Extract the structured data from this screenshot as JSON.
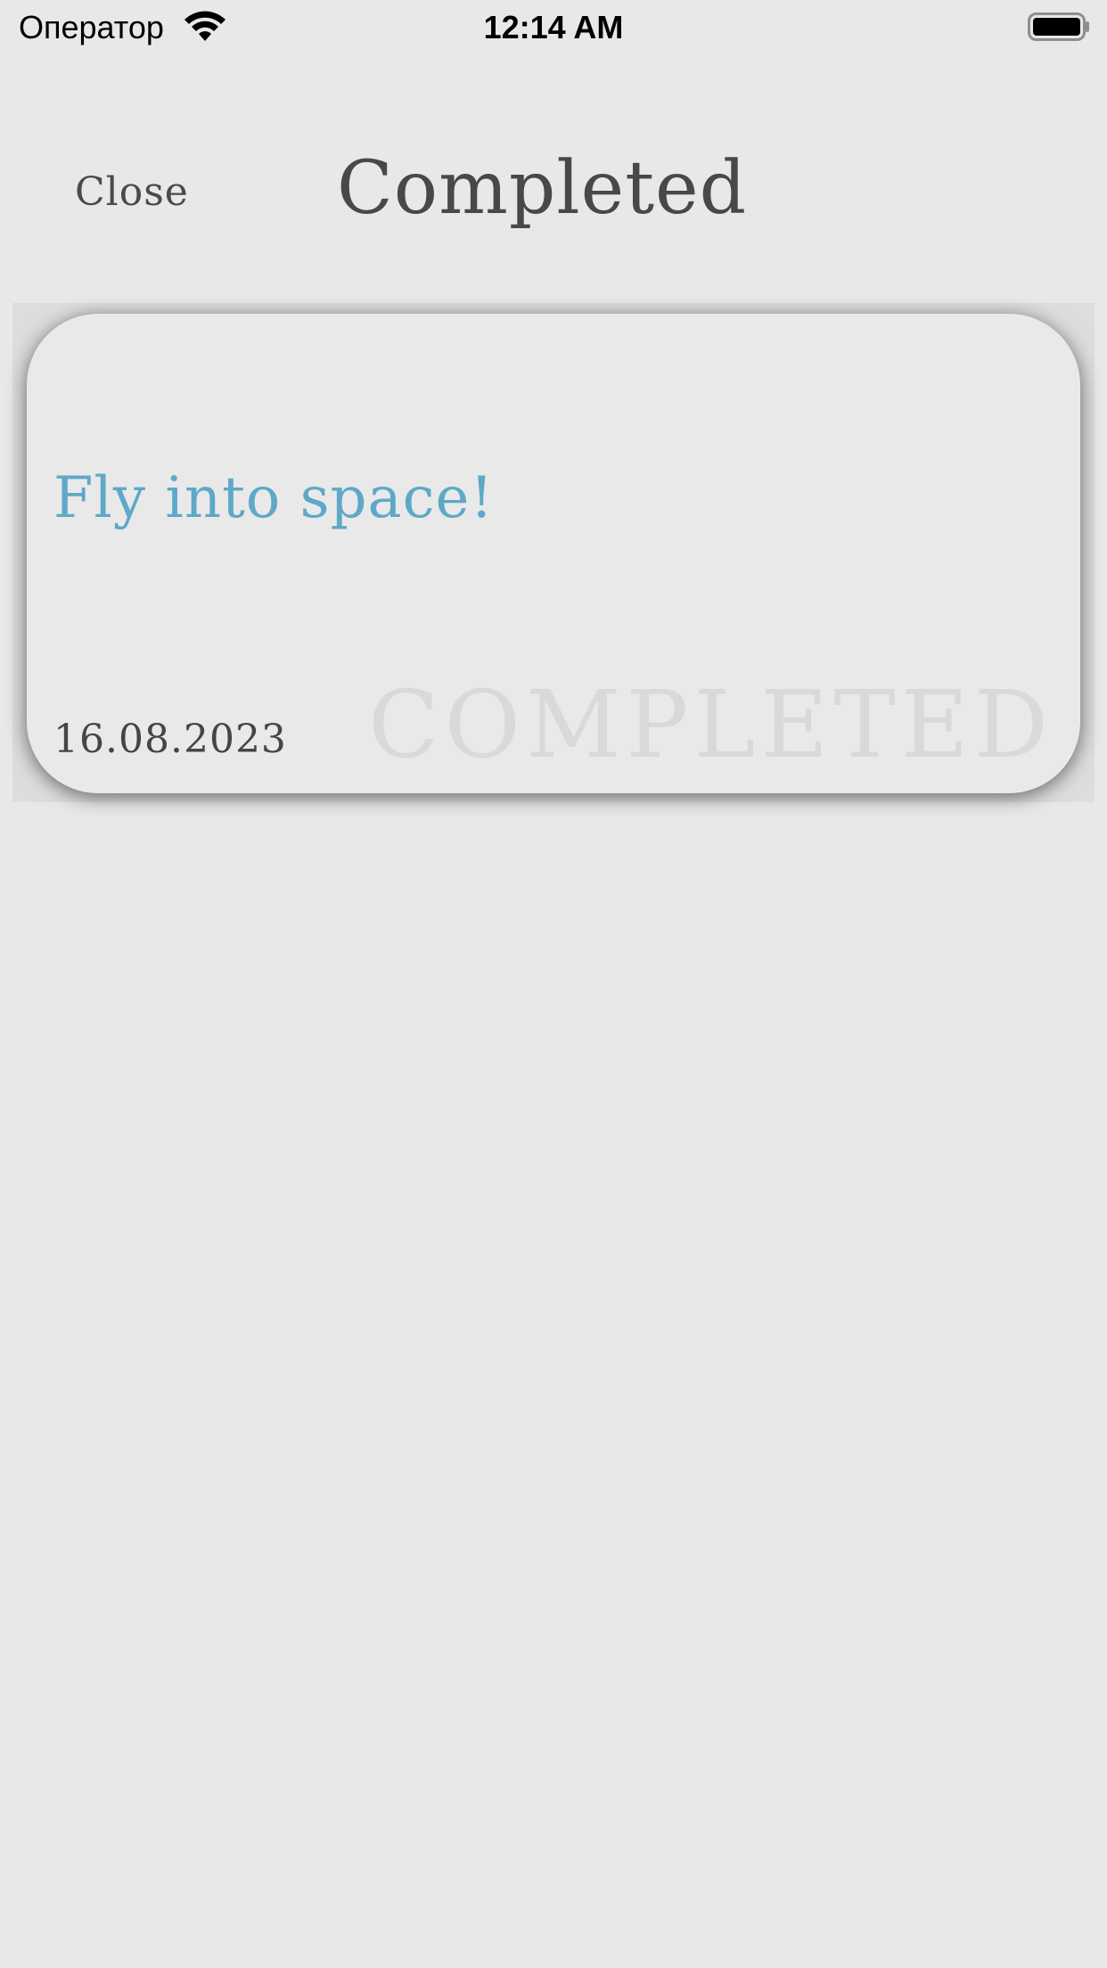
{
  "status_bar": {
    "carrier": "Оператор",
    "time": "12:14 AM",
    "wifi_icon": "wifi-icon",
    "battery_icon": "battery-icon"
  },
  "nav": {
    "close_label": "Close",
    "title": "Completed"
  },
  "task": {
    "title": "Fly into space!",
    "date": "16.08.2023",
    "stamp": "COMPLETED"
  },
  "colors": {
    "background": "#e8e8e9",
    "title_text": "#484848",
    "task_title": "#5ea8c8",
    "date_text": "#454545",
    "stamp_text": "#d7d7d7"
  }
}
